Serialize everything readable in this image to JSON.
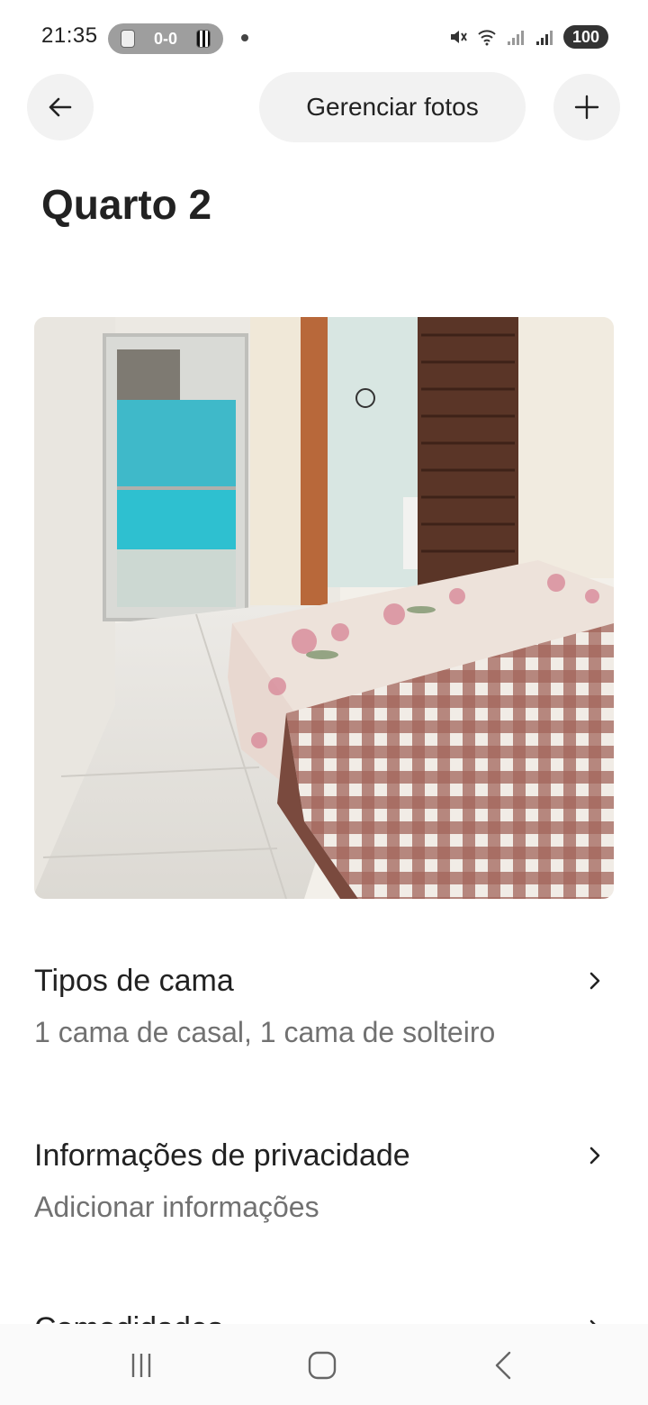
{
  "status_bar": {
    "time": "21:35",
    "score": "0-0",
    "battery": "100",
    "icons": [
      "team-crest-icon",
      "santos-crest-icon",
      "mute-icon",
      "wifi-icon",
      "signal-icon",
      "signal-icon"
    ]
  },
  "header": {
    "back_icon": "arrow-left-icon",
    "manage_photos_label": "Gerenciar fotos",
    "add_icon": "plus-icon"
  },
  "page": {
    "title": "Quarto 2"
  },
  "photo": {
    "subject": "bedroom-photo"
  },
  "settings": [
    {
      "title": "Tipos de cama",
      "subtitle": "1 cama de casal, 1 cama de solteiro"
    },
    {
      "title": "Informações de privacidade",
      "subtitle": "Adicionar informações"
    },
    {
      "title": "Comodidades",
      "subtitle": ""
    }
  ],
  "nav_bar": {
    "icons": [
      "recent-apps-icon",
      "home-icon",
      "back-icon"
    ]
  },
  "colors": {
    "text_primary": "#222222",
    "text_secondary": "#717171",
    "button_bg": "#f2f2f2"
  }
}
